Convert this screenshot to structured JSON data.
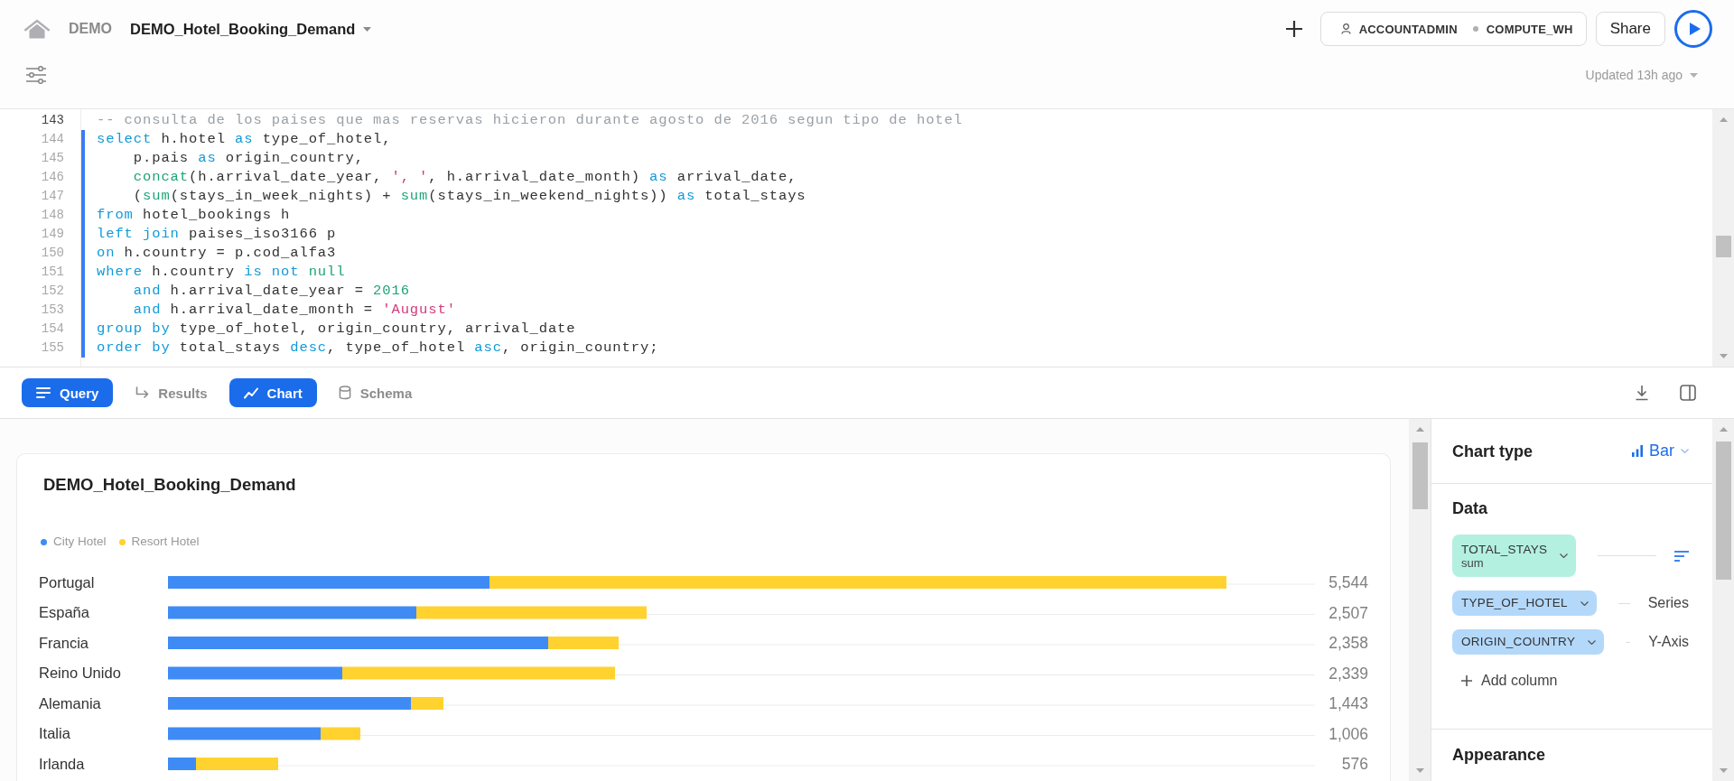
{
  "header": {
    "breadcrumb": "DEMO",
    "title": "DEMO_Hotel_Booking_Demand",
    "role": "ACCOUNTADMIN",
    "warehouse": "COMPUTE_WH",
    "share": "Share",
    "updated": "Updated 13h ago"
  },
  "editor": {
    "lines": [
      {
        "number": "143",
        "cursor": true,
        "highlighted": false,
        "tokens": [
          {
            "kind": "comment",
            "text": "-- consulta de los paises que mas reservas hicieron durante agosto de 2016 segun tipo de hotel"
          }
        ]
      },
      {
        "number": "144",
        "cursor": false,
        "highlighted": true,
        "tokens": [
          {
            "kind": "keyword",
            "text": "select"
          },
          {
            "kind": "plain",
            "text": " h.hotel "
          },
          {
            "kind": "keyword",
            "text": "as"
          },
          {
            "kind": "plain",
            "text": " type_of_hotel,"
          }
        ]
      },
      {
        "number": "145",
        "cursor": false,
        "highlighted": true,
        "tokens": [
          {
            "kind": "plain",
            "text": "    p.pais "
          },
          {
            "kind": "keyword",
            "text": "as"
          },
          {
            "kind": "plain",
            "text": " origin_country,"
          }
        ]
      },
      {
        "number": "146",
        "cursor": false,
        "highlighted": true,
        "tokens": [
          {
            "kind": "function",
            "text": "    concat"
          },
          {
            "kind": "plain",
            "text": "(h.arrival_date_year, "
          },
          {
            "kind": "string",
            "text": "', '"
          },
          {
            "kind": "plain",
            "text": ", h.arrival_date_month) "
          },
          {
            "kind": "keyword",
            "text": "as"
          },
          {
            "kind": "plain",
            "text": " arrival_date,"
          }
        ]
      },
      {
        "number": "147",
        "cursor": false,
        "highlighted": true,
        "tokens": [
          {
            "kind": "plain",
            "text": "    ("
          },
          {
            "kind": "function",
            "text": "sum"
          },
          {
            "kind": "plain",
            "text": "(stays_in_week_nights) + "
          },
          {
            "kind": "function",
            "text": "sum"
          },
          {
            "kind": "plain",
            "text": "(stays_in_weekend_nights)) "
          },
          {
            "kind": "keyword",
            "text": "as"
          },
          {
            "kind": "plain",
            "text": " total_stays"
          }
        ]
      },
      {
        "number": "148",
        "cursor": false,
        "highlighted": true,
        "tokens": [
          {
            "kind": "keyword",
            "text": "from"
          },
          {
            "kind": "plain",
            "text": " hotel_bookings h"
          }
        ]
      },
      {
        "number": "149",
        "cursor": false,
        "highlighted": true,
        "tokens": [
          {
            "kind": "keyword",
            "text": "left join"
          },
          {
            "kind": "plain",
            "text": " paises_iso3166 p"
          }
        ]
      },
      {
        "number": "150",
        "cursor": false,
        "highlighted": true,
        "tokens": [
          {
            "kind": "keyword",
            "text": "on"
          },
          {
            "kind": "plain",
            "text": " h.country = p.cod_alfa3"
          }
        ]
      },
      {
        "number": "151",
        "cursor": false,
        "highlighted": true,
        "tokens": [
          {
            "kind": "keyword",
            "text": "where"
          },
          {
            "kind": "plain",
            "text": " h.country "
          },
          {
            "kind": "keyword",
            "text": "is not"
          },
          {
            "kind": "literal",
            "text": " null"
          }
        ]
      },
      {
        "number": "152",
        "cursor": false,
        "highlighted": true,
        "tokens": [
          {
            "kind": "keyword",
            "text": "    and"
          },
          {
            "kind": "plain",
            "text": " h.arrival_date_year = "
          },
          {
            "kind": "literal",
            "text": "2016"
          }
        ]
      },
      {
        "number": "153",
        "cursor": false,
        "highlighted": true,
        "tokens": [
          {
            "kind": "keyword",
            "text": "    and"
          },
          {
            "kind": "plain",
            "text": " h.arrival_date_month = "
          },
          {
            "kind": "string",
            "text": "'August'"
          }
        ]
      },
      {
        "number": "154",
        "cursor": false,
        "highlighted": true,
        "tokens": [
          {
            "kind": "keyword",
            "text": "group by"
          },
          {
            "kind": "plain",
            "text": " type_of_hotel, origin_country, arrival_date"
          }
        ]
      },
      {
        "number": "155",
        "cursor": false,
        "highlighted": true,
        "tokens": [
          {
            "kind": "keyword",
            "text": "order by"
          },
          {
            "kind": "plain",
            "text": " total_stays "
          },
          {
            "kind": "keyword",
            "text": "desc"
          },
          {
            "kind": "plain",
            "text": ", type_of_hotel "
          },
          {
            "kind": "keyword",
            "text": "asc"
          },
          {
            "kind": "plain",
            "text": ", origin_country;"
          }
        ]
      }
    ]
  },
  "tabs": [
    {
      "kind": "query",
      "label": "Query",
      "selected": true
    },
    {
      "kind": "results",
      "label": "Results",
      "selected": false
    },
    {
      "kind": "chart",
      "label": "Chart",
      "selected": true
    },
    {
      "kind": "schema",
      "label": "Schema",
      "selected": false
    }
  ],
  "chart": {
    "title": "DEMO_Hotel_Booking_Demand",
    "legend": [
      {
        "name": "City Hotel",
        "color": "#3f8bf5"
      },
      {
        "name": "Resort Hotel",
        "color": "#ffd22f"
      }
    ],
    "rows": [
      {
        "category": "Portugal",
        "total": "5,544"
      },
      {
        "category": "España",
        "total": "2,507"
      },
      {
        "category": "Francia",
        "total": "2,358"
      },
      {
        "category": "Reino Unido",
        "total": "2,339"
      },
      {
        "category": "Alemania",
        "total": "1,443"
      },
      {
        "category": "Italia",
        "total": "1,006"
      },
      {
        "category": "Irlanda",
        "total": "576"
      }
    ]
  },
  "chart_settings": {
    "chart_type_title": "Chart type",
    "chart_type": "Bar",
    "data_title": "Data",
    "columns": [
      {
        "kind": "measure",
        "name": "TOTAL_STAYS",
        "aggregation": "sum"
      },
      {
        "kind": "dimension",
        "name": "TYPE_OF_HOTEL",
        "role": "Series"
      },
      {
        "kind": "dimension",
        "name": "ORIGIN_COUNTRY",
        "role": "Y-Axis"
      }
    ],
    "add_column": "Add column",
    "appearance_title": "Appearance"
  }
}
